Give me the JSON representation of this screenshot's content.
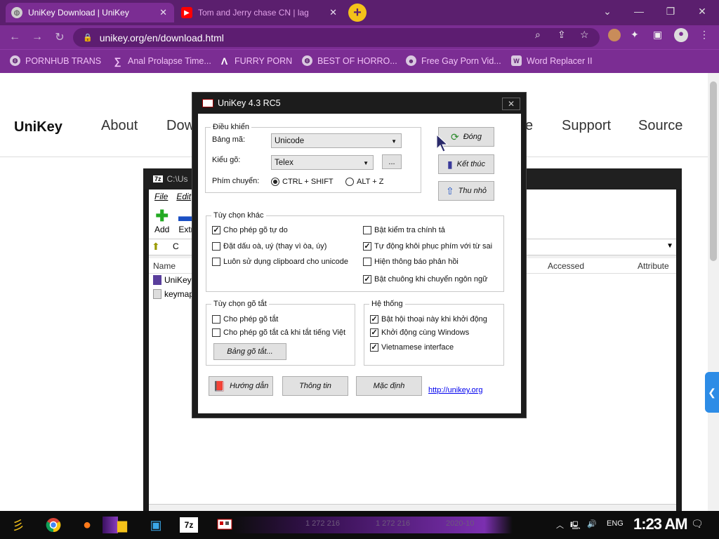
{
  "browser": {
    "tabs": [
      {
        "title": "UniKey Download | UniKey",
        "active": true
      },
      {
        "title": "Tom and Jerry chase CN | lag",
        "active": false
      }
    ],
    "url": "unikey.org/en/download.html",
    "bookmarks": [
      "PORNHUB TRANS",
      "Anal Prolapse Time...",
      "FURRY PORN",
      "BEST OF HORRO...",
      "Free Gay Porn Vid...",
      "Word Replacer II"
    ],
    "colors": {
      "frame": "#5b1f6e",
      "toolbar": "#7b2d93",
      "bookmark_text": "#f2c2f7"
    }
  },
  "site": {
    "logo": "UniKey",
    "nav": [
      "About",
      "Dow",
      "e",
      "Support",
      "Source"
    ]
  },
  "zip": {
    "title": "C:\\Us",
    "menu": [
      "File",
      "Edit"
    ],
    "tools": [
      "Add",
      "Extr"
    ],
    "addr_prefix": "C",
    "columns": [
      "Name",
      "Accessed",
      "Attribute"
    ],
    "rows": [
      "UniKeyN",
      "keymap"
    ],
    "status": {
      "size1": "1 272 216",
      "size2": "1 272 216",
      "date": "2020-10"
    }
  },
  "unikey": {
    "title": "UniKey 4.3 RC5",
    "control": {
      "group_title": "Điều khiển",
      "charset_label": "Bảng mã:",
      "charset_value": "Unicode",
      "input_label": "Kiểu gõ:",
      "input_value": "Telex",
      "more_label": "...",
      "switch_label": "Phím chuyển:",
      "switch_ctrl_shift": "CTRL + SHIFT",
      "switch_alt_z": "ALT + Z"
    },
    "buttons": {
      "close": "Đóng",
      "exit": "Kết thúc",
      "minimize": "Thu nhỏ",
      "help": "Hướng dẫn",
      "info": "Thông tin",
      "default": "Mặc định",
      "macro_table": "Bảng gõ tắt..."
    },
    "other_options": {
      "group_title": "Tùy chọn khác",
      "items": [
        {
          "label": "Cho phép gõ tự do",
          "checked": true
        },
        {
          "label": "Đặt dấu oà, uý (thay vì òa, úy)",
          "checked": false
        },
        {
          "label": "Luôn sử dụng clipboard cho unicode",
          "checked": false
        },
        {
          "label": "Bật kiểm tra chính tả",
          "checked": false
        },
        {
          "label": "Tự động khôi phục phím với từ sai",
          "checked": true
        },
        {
          "label": "Hiện thông báo phản hồi",
          "checked": false
        },
        {
          "label": "Bật chuông khi chuyển ngôn ngữ",
          "checked": true
        }
      ]
    },
    "macro_options": {
      "group_title": "Tùy chọn gõ tắt",
      "items": [
        {
          "label": "Cho phép gõ tắt",
          "checked": false
        },
        {
          "label": "Cho phép gõ tắt cả khi tắt tiếng Việt",
          "checked": false
        }
      ]
    },
    "system": {
      "group_title": "Hệ thống",
      "items": [
        {
          "label": "Bật hội thoại này khi khởi động",
          "checked": true
        },
        {
          "label": "Khởi động cùng Windows",
          "checked": true
        },
        {
          "label": "Vietnamese interface",
          "checked": true
        }
      ]
    },
    "link": "http://unikey.org"
  },
  "taskbar": {
    "lang": "ENG",
    "time": "1:23 AM"
  }
}
